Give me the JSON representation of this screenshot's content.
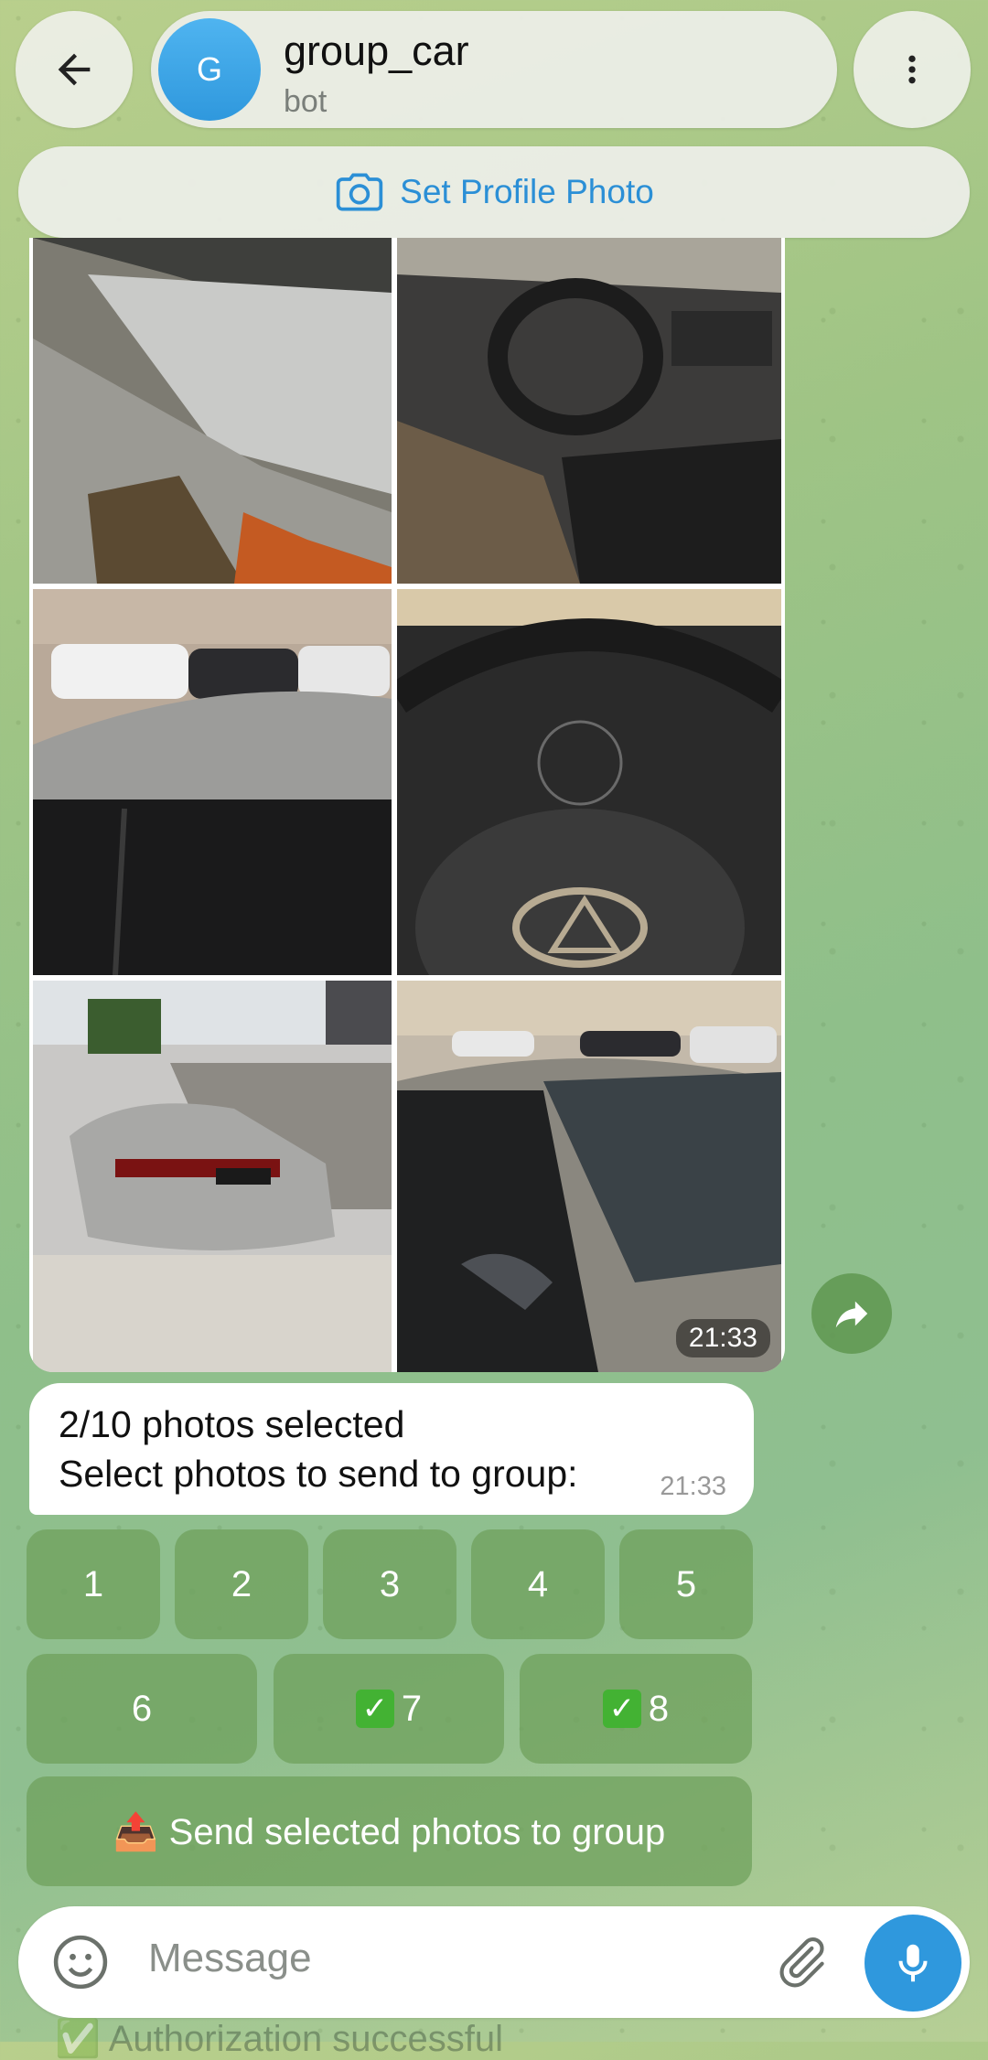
{
  "header": {
    "avatar_letter": "G",
    "title": "group_car",
    "subtitle": "bot"
  },
  "profile_bar": {
    "label": "Set Profile Photo"
  },
  "album": {
    "photos": [
      {
        "alt": "Damaged front bumper of silver sedan"
      },
      {
        "alt": "Lexus interior, damaged dashboard"
      },
      {
        "alt": "Parked cars in lot, dented roof"
      },
      {
        "alt": "Lexus steering wheel"
      },
      {
        "alt": "Silver Lexus rear view in lot"
      },
      {
        "alt": "Shattered windshield of silver Lexus"
      }
    ],
    "time": "21:33"
  },
  "message": {
    "line1": "2/10 photos selected",
    "line2": "Select photos to send to group:",
    "time": "21:33"
  },
  "keyboard": {
    "row1": [
      "1",
      "2",
      "3",
      "4",
      "5"
    ],
    "row2": [
      "6",
      "7",
      "8"
    ],
    "send_label": "📤 Send selected photos to group"
  },
  "composer": {
    "placeholder": "Message"
  },
  "below_text": "✅ Authorization successful"
}
